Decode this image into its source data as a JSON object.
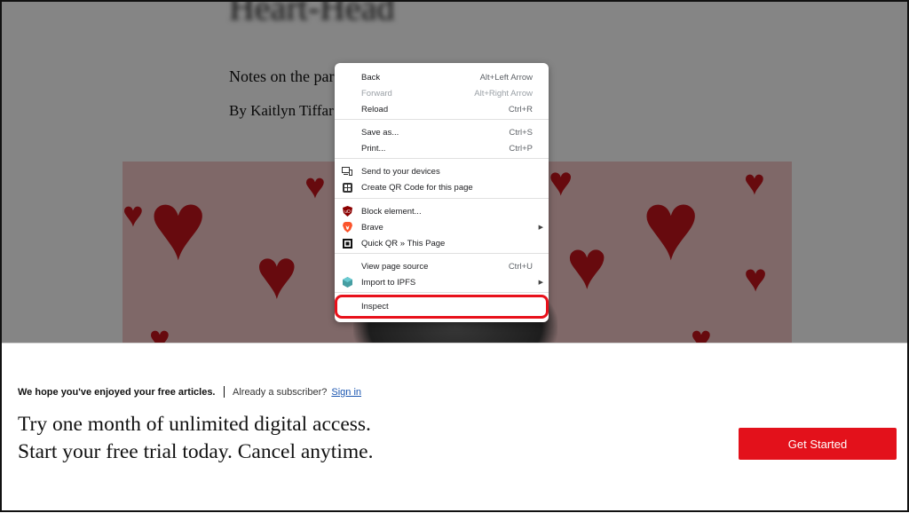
{
  "article": {
    "headline": "Heart-Head",
    "subhead": "Notes on the par",
    "byline": "By Kaitlyn Tiffar"
  },
  "context_menu": {
    "items": [
      {
        "label": "Back",
        "shortcut": "Alt+Left Arrow"
      },
      {
        "label": "Forward",
        "shortcut": "Alt+Right Arrow",
        "disabled": true
      },
      {
        "label": "Reload",
        "shortcut": "Ctrl+R"
      },
      {
        "label": "Save as...",
        "shortcut": "Ctrl+S"
      },
      {
        "label": "Print...",
        "shortcut": "Ctrl+P"
      },
      {
        "label": "Send to your devices",
        "icon": "devices-icon"
      },
      {
        "label": "Create QR Code for this page",
        "icon": "qr-code-icon"
      },
      {
        "label": "Block element...",
        "icon": "ublock-icon"
      },
      {
        "label": "Brave",
        "icon": "brave-icon",
        "submenu": true
      },
      {
        "label": "Quick QR » This Page",
        "icon": "quick-qr-icon"
      },
      {
        "label": "View page source",
        "shortcut": "Ctrl+U"
      },
      {
        "label": "Import to IPFS",
        "icon": "ipfs-icon",
        "submenu": true
      },
      {
        "label": "Inspect"
      }
    ]
  },
  "paywall": {
    "enjoyed": "We hope you've enjoyed your free articles.",
    "subscriber": "Already a subscriber?",
    "signin": "Sign in",
    "line1": "Try one month of unlimited digital access.",
    "line2": "Start your free trial today. Cancel anytime.",
    "cta": "Get Started"
  },
  "colors": {
    "accent_red": "#e3111b",
    "heart_red": "#c5141b",
    "link_blue": "#1a55b0"
  }
}
